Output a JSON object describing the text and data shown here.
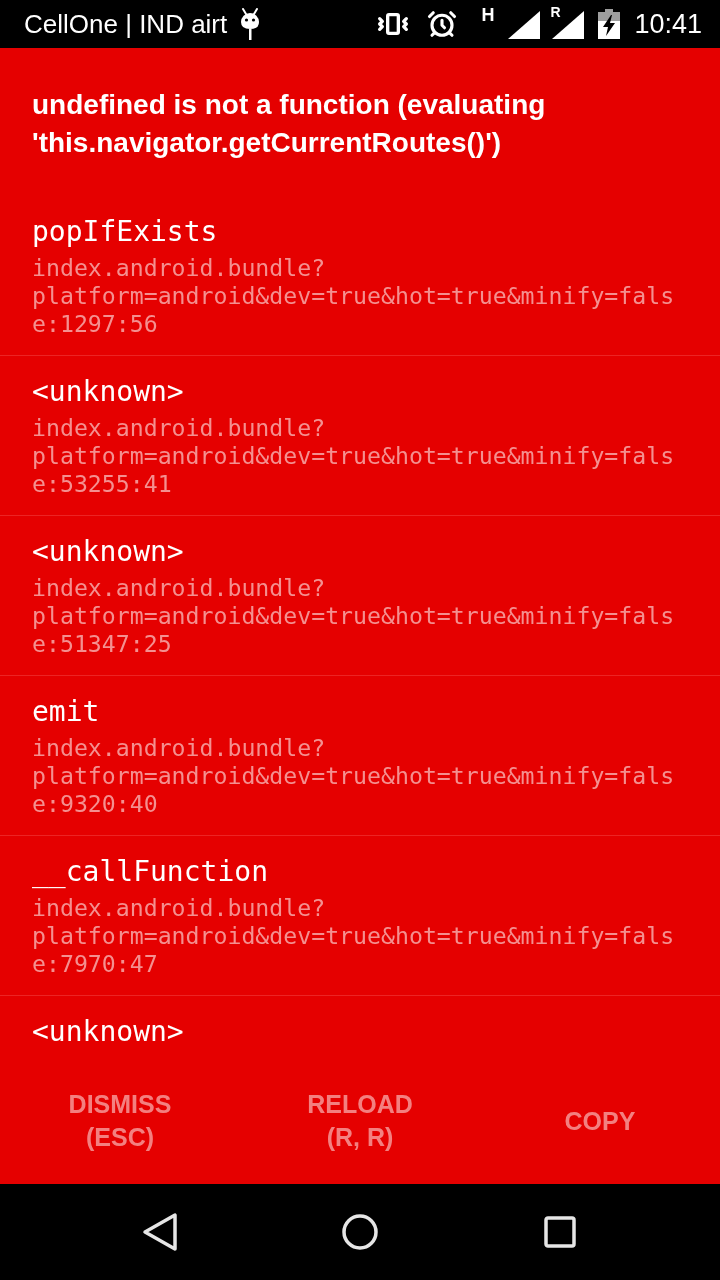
{
  "status_bar": {
    "carrier": "CellOne | IND airt",
    "network_type": "H",
    "roaming": "R",
    "time": "10:41"
  },
  "error": {
    "message": "undefined is not a function (evaluating 'this.navigator.getCurrentRoutes()')"
  },
  "stack_frames": [
    {
      "method": "popIfExists",
      "file": "index.android.bundle?platform=android&dev=true&hot=true&minify=false:1297:56"
    },
    {
      "method": "<unknown>",
      "file": "index.android.bundle?platform=android&dev=true&hot=true&minify=false:53255:41"
    },
    {
      "method": "<unknown>",
      "file": "index.android.bundle?platform=android&dev=true&hot=true&minify=false:51347:25"
    },
    {
      "method": "emit",
      "file": "index.android.bundle?platform=android&dev=true&hot=true&minify=false:9320:40"
    },
    {
      "method": "__callFunction",
      "file": "index.android.bundle?platform=android&dev=true&hot=true&minify=false:7970:47"
    },
    {
      "method": "<unknown>"
    }
  ],
  "buttons": [
    {
      "label": "DISMISS\n(ESC)"
    },
    {
      "label": "RELOAD\n(R, R)"
    },
    {
      "label": "COPY"
    }
  ]
}
